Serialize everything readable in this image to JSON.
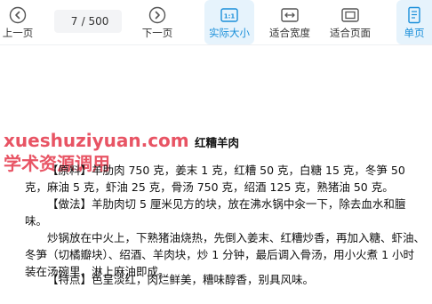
{
  "toolbar": {
    "prev_label": "上一页",
    "page_current": "7",
    "page_total": "/ 500",
    "next_label": "下一页",
    "actual_size_label": "实际大小",
    "fit_width_label": "适合宽度",
    "fit_page_label": "适合页面",
    "single_page_label": "单页",
    "actual_size_icon_text": "1:1"
  },
  "watermark": {
    "line1": "xueshuziyuan.com",
    "line2": "学术资源调用"
  },
  "document": {
    "title": "红糟羊肉",
    "paragraphs": [
      "【原料】羊肋肉 750 克，姜末 1 克，红糟 50 克，白糖 15 克，冬笋 50 克，麻油 5 克，虾油 25 克，骨汤 750 克，绍酒 125 克，熟猪油 50 克。",
      "【做法】羊肋肉切 5 厘米见方的块，放在沸水锅中汆一下，除去血水和膻味。",
      "炒锅放在中火上，下熟猪油烧热，先倒入姜末、红糟炒香，再加入糖、虾油、冬笋（切橘瓣块）、绍酒、羊肉块，炒 1 分钟，最后调入骨汤，用小火煮 1 小时装在汤碗里，淋上麻油即成。",
      "【特点】色呈淡红，肉烂鲜美，糟味醇香，别具风味。"
    ]
  },
  "colors": {
    "accent": "#1a8fd9",
    "active_bg": "#e6f3fc",
    "watermark": "#e4374a"
  }
}
